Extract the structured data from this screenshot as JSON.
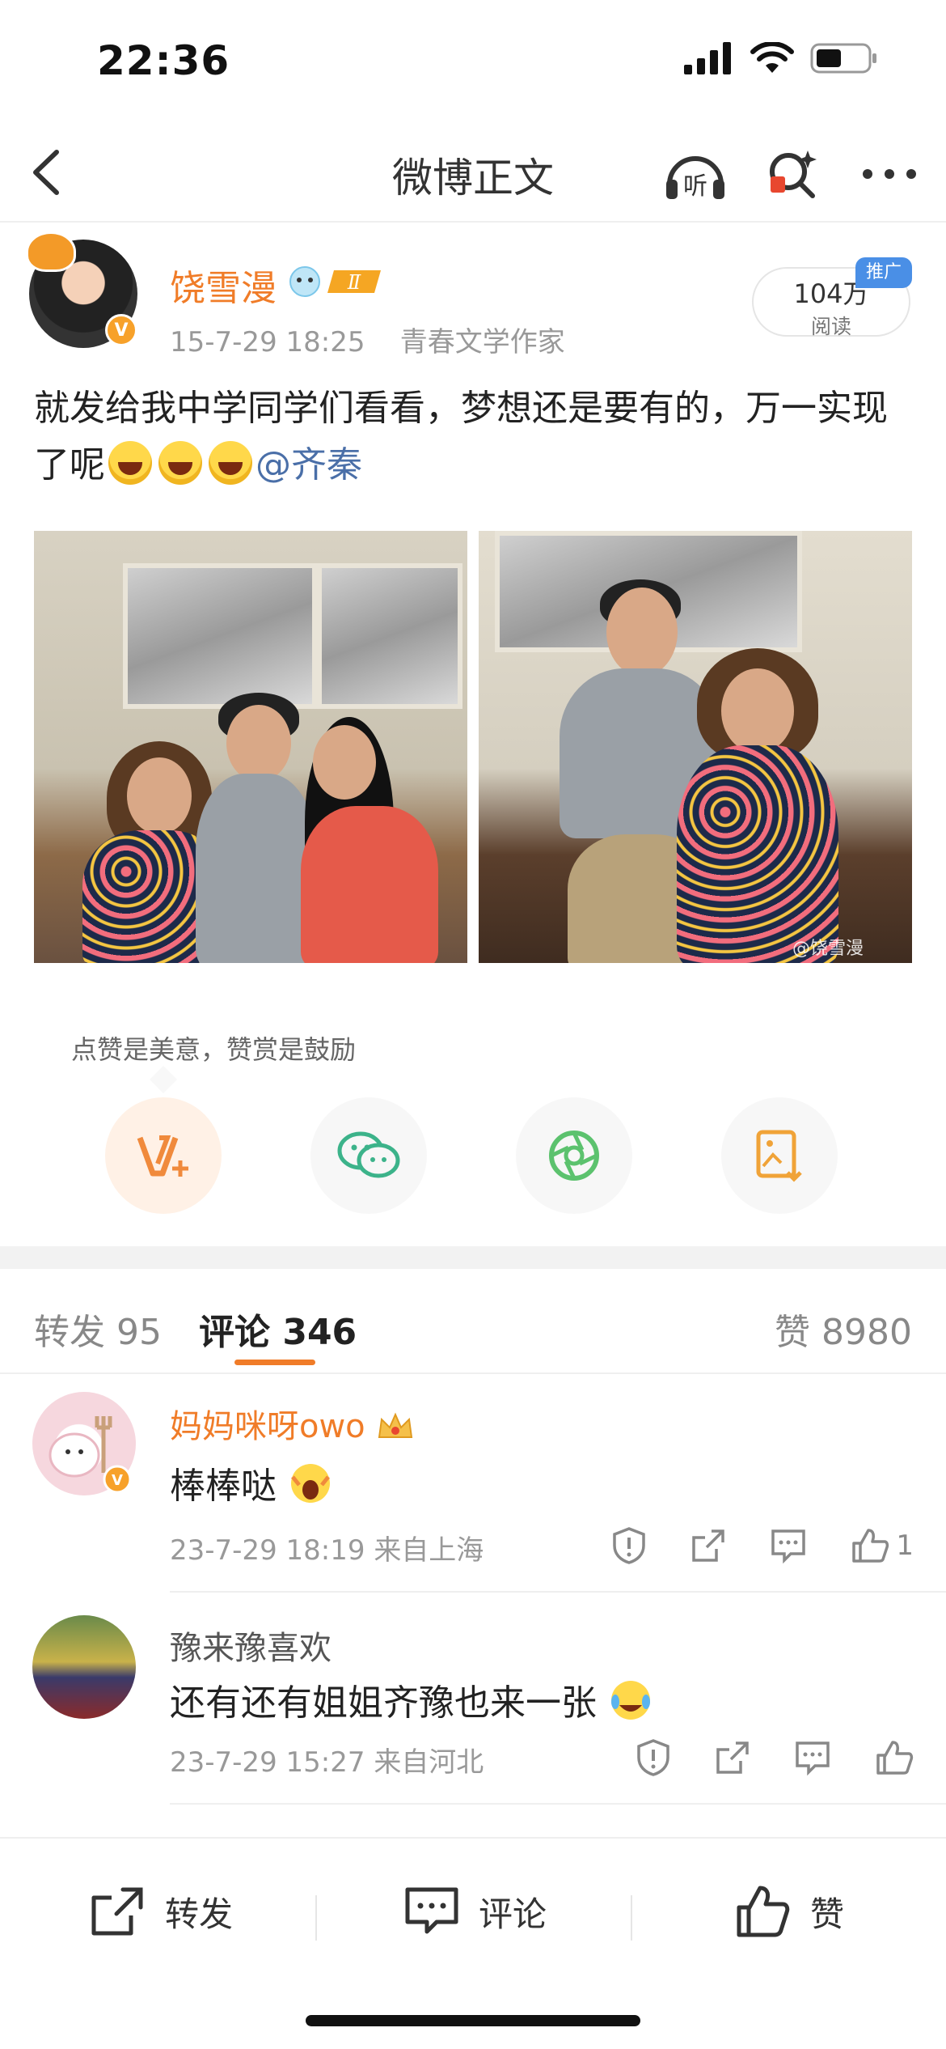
{
  "status": {
    "time": "22:36"
  },
  "nav": {
    "title": "微博正文",
    "listen_label": "听"
  },
  "post": {
    "author": "饶雪漫",
    "level_badge": "Ⅱ",
    "date": "15-7-29 18:25",
    "author_title": "青春文学作家",
    "read_count": "104万",
    "read_label": "阅读",
    "promo_label": "推广",
    "text": "就发给我中学同学们看看，梦想还是要有的，万一实现了呢",
    "mention": "@齐秦",
    "watermark": "@饶雪漫"
  },
  "reward": {
    "tip": "点赞是美意，赞赏是鼓励"
  },
  "tabs": {
    "repost_label": "转发",
    "repost_count": "95",
    "comment_label": "评论",
    "comment_count": "346",
    "like_label": "赞",
    "like_count": "8980"
  },
  "comments": [
    {
      "name": "妈妈咪呀owo",
      "text": "棒棒哒",
      "date": "23-7-29 18:19",
      "location": "来自上海",
      "likes": "1"
    },
    {
      "name": "豫来豫喜欢",
      "text": "还有还有姐姐齐豫也来一张",
      "date": "23-7-29 15:27",
      "location": "来自河北",
      "likes": ""
    }
  ],
  "bottom_bar": {
    "repost": "转发",
    "comment": "评论",
    "like": "赞"
  },
  "colors": {
    "accent": "#f07c28",
    "link": "#4a6fa8",
    "promo": "#4a8fe6"
  }
}
